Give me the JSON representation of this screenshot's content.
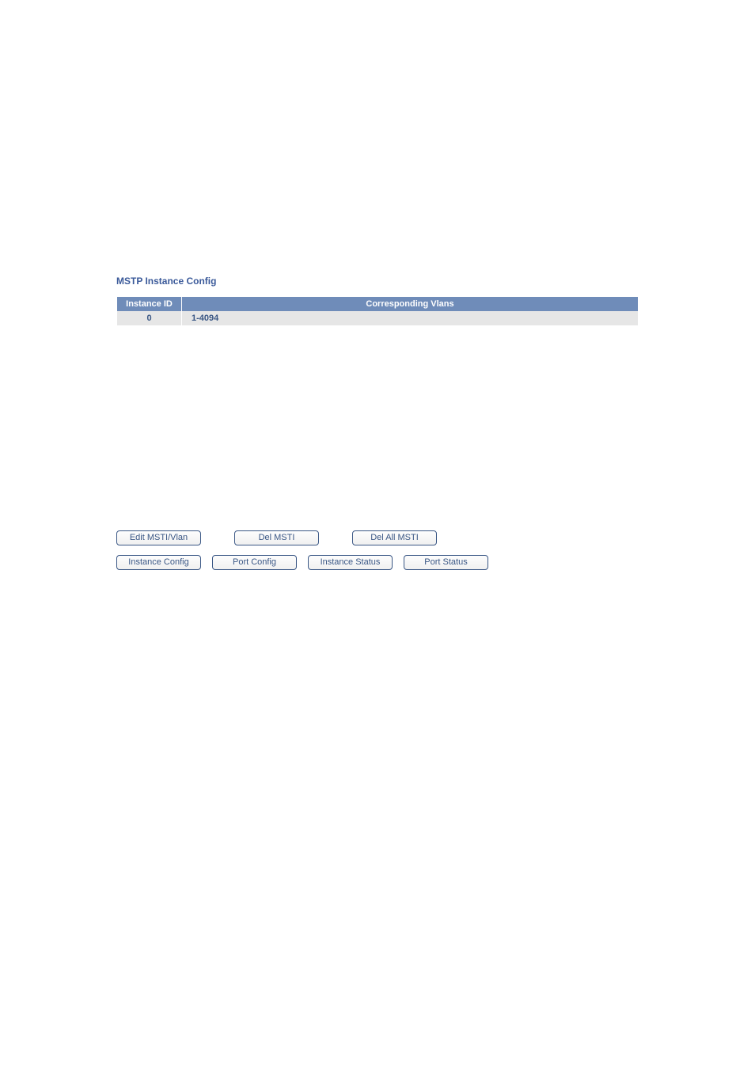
{
  "title": "MSTP Instance Config",
  "table": {
    "headers": {
      "instance_id": "Instance ID",
      "corresponding_vlans": "Corresponding Vlans"
    },
    "rows": [
      {
        "id": "0",
        "vlans": "1-4094"
      }
    ]
  },
  "actions_row1": {
    "edit_msti_vlan": "Edit MSTI/Vlan",
    "del_msti": "Del MSTI",
    "del_all_msti": "Del All MSTI"
  },
  "actions_row2": {
    "instance_config": "Instance Config",
    "port_config": "Port Config",
    "instance_status": "Instance Status",
    "port_status": "Port Status"
  }
}
